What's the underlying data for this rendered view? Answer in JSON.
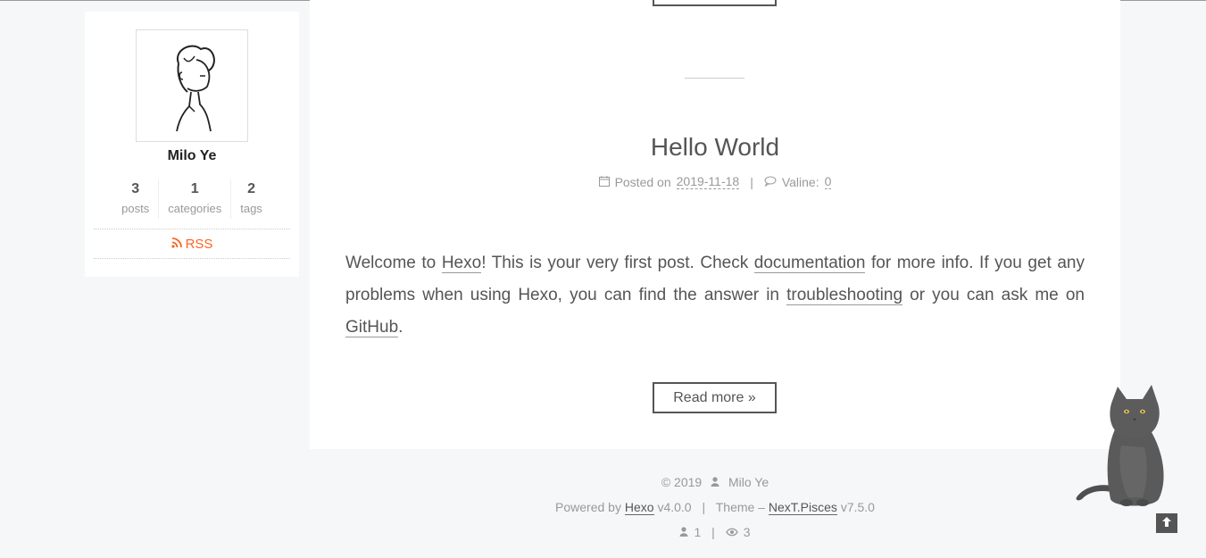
{
  "sidebar": {
    "author_name": "Milo Ye",
    "stats": [
      {
        "count": "3",
        "label": "posts"
      },
      {
        "count": "1",
        "label": "categories"
      },
      {
        "count": "2",
        "label": "tags"
      }
    ],
    "rss_label": "RSS",
    "rss_color": "#fc6423"
  },
  "post": {
    "title": "Hello World",
    "posted_on_label": "Posted on",
    "date": "2019-11-18",
    "comments_label": "Valine:",
    "comments_count": "0",
    "body_parts": {
      "p1": "Welcome to ",
      "link1": "Hexo",
      "p2": "! This is your very first post. Check ",
      "link2": "documentation",
      "p3": " for more info. If you get any problems when using Hexo, you can find the answer in ",
      "link3": "troubleshooting",
      "p4": " or you can ask me on ",
      "link4": "GitHub",
      "p5": "."
    },
    "read_more_label": "Read more »"
  },
  "footer": {
    "copyright": "© 2019",
    "owner": "Milo Ye",
    "powered_by_label": "Powered by",
    "hexo_link": "Hexo",
    "hexo_version": "v4.0.0",
    "theme_label": "Theme –",
    "theme_link": "NexT.Pisces",
    "theme_version": "v7.5.0",
    "visitors": "1",
    "views": "3"
  }
}
